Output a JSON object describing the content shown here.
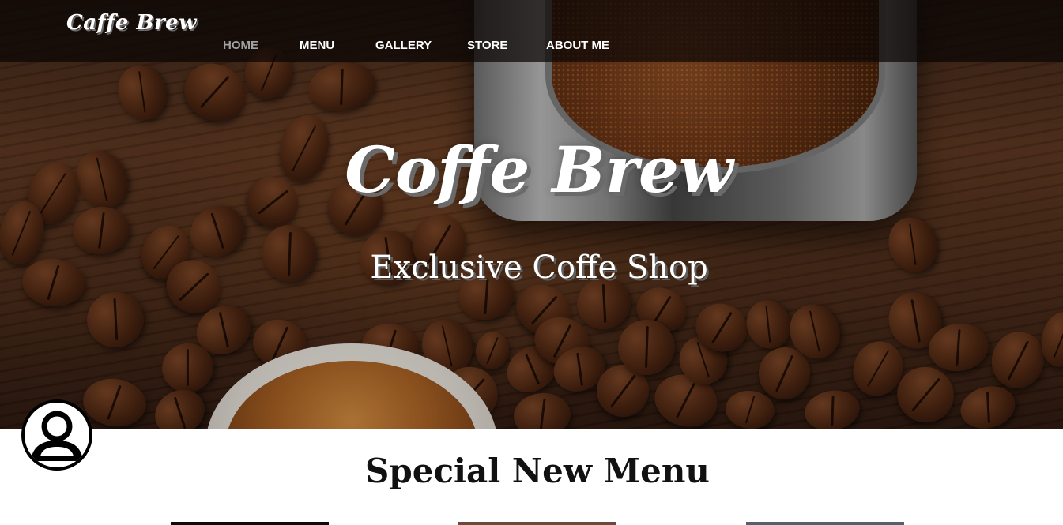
{
  "navbar": {
    "brand": "Caffe Brew",
    "links": [
      {
        "label": "HOME",
        "active": true
      },
      {
        "label": "MENU",
        "active": false
      },
      {
        "label": "GALLERY",
        "active": false
      },
      {
        "label": "STORE",
        "active": false
      },
      {
        "label": "ABOUT ME",
        "active": false
      }
    ]
  },
  "hero": {
    "title": "Coffe Brew",
    "subtitle": "Exclusive Coffe Shop"
  },
  "menu_section": {
    "title": "Special New Menu"
  },
  "icons": {
    "avatar": "user-avatar-icon"
  },
  "colors": {
    "nav_active": "#a3a3a3",
    "nav_text": "#ffffff",
    "hero_text": "#ffffff",
    "section_title": "#111111"
  }
}
